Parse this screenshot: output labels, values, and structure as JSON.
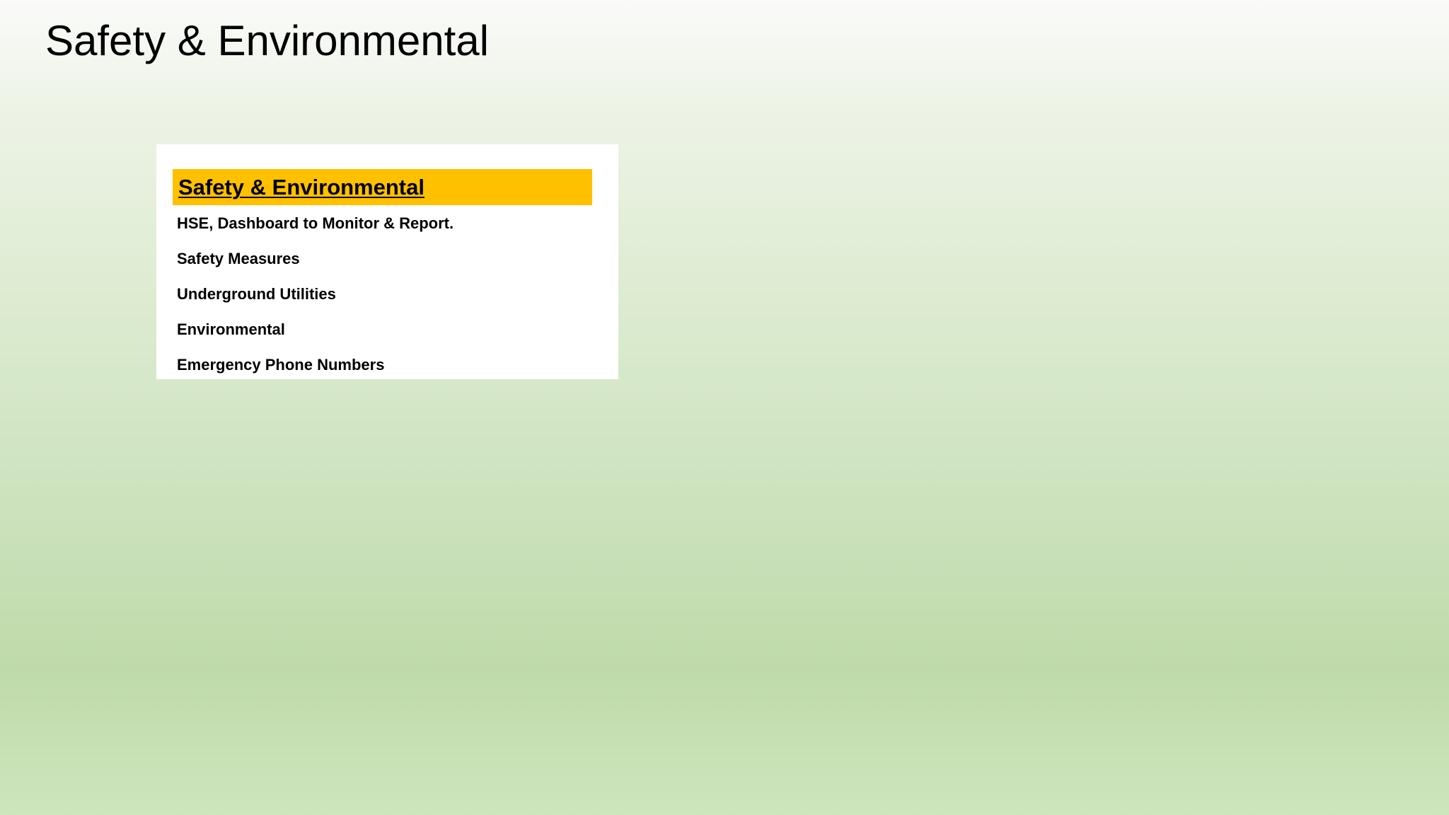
{
  "page": {
    "title": "Safety & Environmental"
  },
  "panel": {
    "header": "Safety & Environmental",
    "items": [
      {
        "label": "HSE, Dashboard to Monitor & Report."
      },
      {
        "label": "Safety Measures"
      },
      {
        "label": "Underground Utilities"
      },
      {
        "label": "Environmental"
      },
      {
        "label": "Emergency Phone Numbers"
      }
    ]
  },
  "colors": {
    "header_background": "#ffc000",
    "panel_background": "#ffffff",
    "text": "#000000"
  }
}
